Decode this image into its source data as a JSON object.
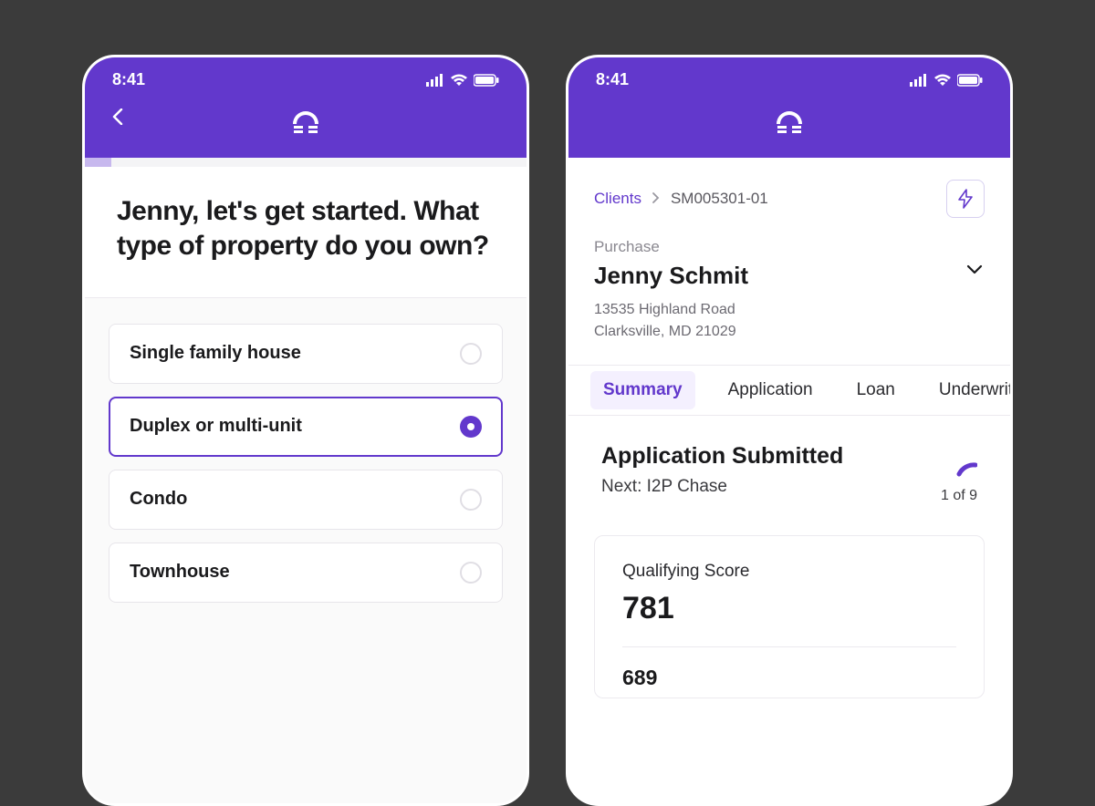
{
  "status_bar": {
    "time": "8:41"
  },
  "left": {
    "question": "Jenny, let's get started. What type of property do you own?",
    "options": [
      {
        "label": "Single family house",
        "selected": false
      },
      {
        "label": "Duplex or multi-unit",
        "selected": true
      },
      {
        "label": "Condo",
        "selected": false
      },
      {
        "label": "Townhouse",
        "selected": false
      }
    ]
  },
  "right": {
    "breadcrumb": {
      "root": "Clients",
      "current": "SM005301-01"
    },
    "client": {
      "type": "Purchase",
      "name": "Jenny Schmit",
      "address1": "13535 Highland Road",
      "address2": "Clarksville, MD 21029"
    },
    "tabs": [
      "Summary",
      "Application",
      "Loan",
      "Underwriting"
    ],
    "active_tab": 0,
    "summary": {
      "status": "Application Submitted",
      "next": "Next: I2P Chase",
      "progress": "1 of 9"
    },
    "score": {
      "label": "Qualifying Score",
      "primary": "781",
      "secondary": "689"
    }
  }
}
